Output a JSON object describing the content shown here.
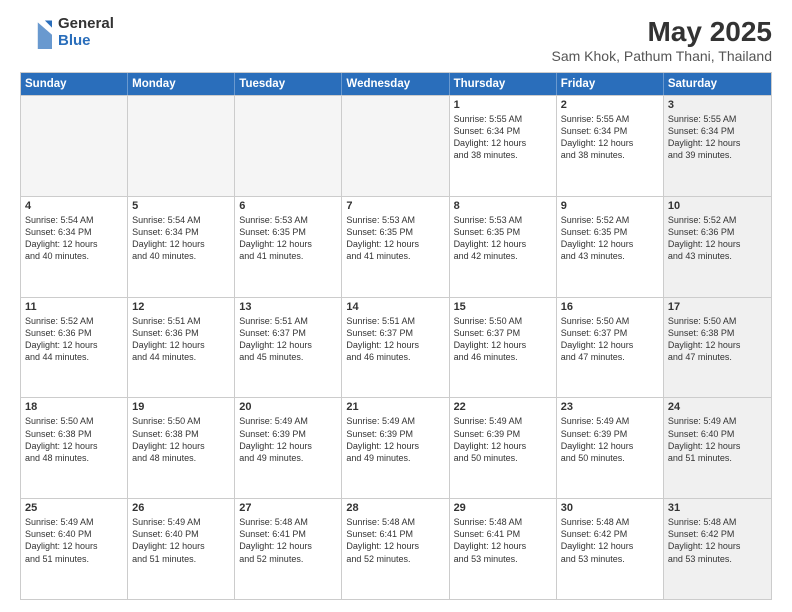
{
  "logo": {
    "general": "General",
    "blue": "Blue"
  },
  "title": "May 2025",
  "subtitle": "Sam Khok, Pathum Thani, Thailand",
  "headers": [
    "Sunday",
    "Monday",
    "Tuesday",
    "Wednesday",
    "Thursday",
    "Friday",
    "Saturday"
  ],
  "rows": [
    [
      {
        "day": "",
        "empty": true,
        "text": ""
      },
      {
        "day": "",
        "empty": true,
        "text": ""
      },
      {
        "day": "",
        "empty": true,
        "text": ""
      },
      {
        "day": "",
        "empty": true,
        "text": ""
      },
      {
        "day": "1",
        "empty": false,
        "text": "Sunrise: 5:55 AM\nSunset: 6:34 PM\nDaylight: 12 hours\nand 38 minutes."
      },
      {
        "day": "2",
        "empty": false,
        "text": "Sunrise: 5:55 AM\nSunset: 6:34 PM\nDaylight: 12 hours\nand 38 minutes."
      },
      {
        "day": "3",
        "empty": false,
        "shaded": true,
        "text": "Sunrise: 5:55 AM\nSunset: 6:34 PM\nDaylight: 12 hours\nand 39 minutes."
      }
    ],
    [
      {
        "day": "4",
        "empty": false,
        "text": "Sunrise: 5:54 AM\nSunset: 6:34 PM\nDaylight: 12 hours\nand 40 minutes."
      },
      {
        "day": "5",
        "empty": false,
        "text": "Sunrise: 5:54 AM\nSunset: 6:34 PM\nDaylight: 12 hours\nand 40 minutes."
      },
      {
        "day": "6",
        "empty": false,
        "text": "Sunrise: 5:53 AM\nSunset: 6:35 PM\nDaylight: 12 hours\nand 41 minutes."
      },
      {
        "day": "7",
        "empty": false,
        "text": "Sunrise: 5:53 AM\nSunset: 6:35 PM\nDaylight: 12 hours\nand 41 minutes."
      },
      {
        "day": "8",
        "empty": false,
        "text": "Sunrise: 5:53 AM\nSunset: 6:35 PM\nDaylight: 12 hours\nand 42 minutes."
      },
      {
        "day": "9",
        "empty": false,
        "text": "Sunrise: 5:52 AM\nSunset: 6:35 PM\nDaylight: 12 hours\nand 43 minutes."
      },
      {
        "day": "10",
        "empty": false,
        "shaded": true,
        "text": "Sunrise: 5:52 AM\nSunset: 6:36 PM\nDaylight: 12 hours\nand 43 minutes."
      }
    ],
    [
      {
        "day": "11",
        "empty": false,
        "text": "Sunrise: 5:52 AM\nSunset: 6:36 PM\nDaylight: 12 hours\nand 44 minutes."
      },
      {
        "day": "12",
        "empty": false,
        "text": "Sunrise: 5:51 AM\nSunset: 6:36 PM\nDaylight: 12 hours\nand 44 minutes."
      },
      {
        "day": "13",
        "empty": false,
        "text": "Sunrise: 5:51 AM\nSunset: 6:37 PM\nDaylight: 12 hours\nand 45 minutes."
      },
      {
        "day": "14",
        "empty": false,
        "text": "Sunrise: 5:51 AM\nSunset: 6:37 PM\nDaylight: 12 hours\nand 46 minutes."
      },
      {
        "day": "15",
        "empty": false,
        "text": "Sunrise: 5:50 AM\nSunset: 6:37 PM\nDaylight: 12 hours\nand 46 minutes."
      },
      {
        "day": "16",
        "empty": false,
        "text": "Sunrise: 5:50 AM\nSunset: 6:37 PM\nDaylight: 12 hours\nand 47 minutes."
      },
      {
        "day": "17",
        "empty": false,
        "shaded": true,
        "text": "Sunrise: 5:50 AM\nSunset: 6:38 PM\nDaylight: 12 hours\nand 47 minutes."
      }
    ],
    [
      {
        "day": "18",
        "empty": false,
        "text": "Sunrise: 5:50 AM\nSunset: 6:38 PM\nDaylight: 12 hours\nand 48 minutes."
      },
      {
        "day": "19",
        "empty": false,
        "text": "Sunrise: 5:50 AM\nSunset: 6:38 PM\nDaylight: 12 hours\nand 48 minutes."
      },
      {
        "day": "20",
        "empty": false,
        "text": "Sunrise: 5:49 AM\nSunset: 6:39 PM\nDaylight: 12 hours\nand 49 minutes."
      },
      {
        "day": "21",
        "empty": false,
        "text": "Sunrise: 5:49 AM\nSunset: 6:39 PM\nDaylight: 12 hours\nand 49 minutes."
      },
      {
        "day": "22",
        "empty": false,
        "text": "Sunrise: 5:49 AM\nSunset: 6:39 PM\nDaylight: 12 hours\nand 50 minutes."
      },
      {
        "day": "23",
        "empty": false,
        "text": "Sunrise: 5:49 AM\nSunset: 6:39 PM\nDaylight: 12 hours\nand 50 minutes."
      },
      {
        "day": "24",
        "empty": false,
        "shaded": true,
        "text": "Sunrise: 5:49 AM\nSunset: 6:40 PM\nDaylight: 12 hours\nand 51 minutes."
      }
    ],
    [
      {
        "day": "25",
        "empty": false,
        "text": "Sunrise: 5:49 AM\nSunset: 6:40 PM\nDaylight: 12 hours\nand 51 minutes."
      },
      {
        "day": "26",
        "empty": false,
        "text": "Sunrise: 5:49 AM\nSunset: 6:40 PM\nDaylight: 12 hours\nand 51 minutes."
      },
      {
        "day": "27",
        "empty": false,
        "text": "Sunrise: 5:48 AM\nSunset: 6:41 PM\nDaylight: 12 hours\nand 52 minutes."
      },
      {
        "day": "28",
        "empty": false,
        "text": "Sunrise: 5:48 AM\nSunset: 6:41 PM\nDaylight: 12 hours\nand 52 minutes."
      },
      {
        "day": "29",
        "empty": false,
        "text": "Sunrise: 5:48 AM\nSunset: 6:41 PM\nDaylight: 12 hours\nand 53 minutes."
      },
      {
        "day": "30",
        "empty": false,
        "text": "Sunrise: 5:48 AM\nSunset: 6:42 PM\nDaylight: 12 hours\nand 53 minutes."
      },
      {
        "day": "31",
        "empty": false,
        "shaded": true,
        "text": "Sunrise: 5:48 AM\nSunset: 6:42 PM\nDaylight: 12 hours\nand 53 minutes."
      }
    ]
  ]
}
